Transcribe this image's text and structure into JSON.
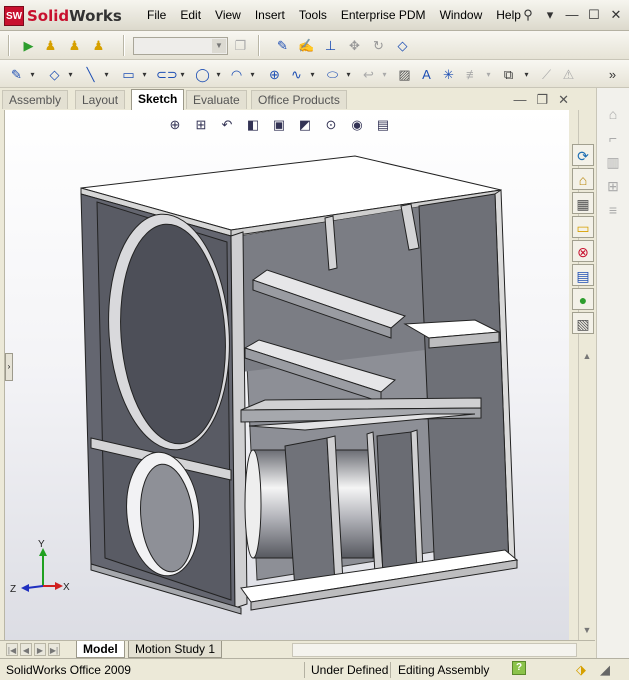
{
  "app": {
    "brand": "SolidWorks",
    "badge": "SW"
  },
  "menu": [
    "File",
    "Edit",
    "View",
    "Insert",
    "Tools",
    "Enterprise PDM",
    "Window",
    "Help"
  ],
  "command_tabs": [
    "Assembly",
    "Layout",
    "Sketch",
    "Evaluate",
    "Office Products"
  ],
  "active_command_tab": "Sketch",
  "bottom_tabs": [
    "Model",
    "Motion Study 1"
  ],
  "active_bottom_tab": "Model",
  "status": {
    "product": "SolidWorks Office 2009",
    "definition": "Under Defined",
    "mode": "Editing Assembly",
    "help": "?"
  },
  "triad": {
    "x": "X",
    "y": "Y",
    "z": "Z"
  },
  "colors": {
    "brand_red": "#c8102e",
    "play_green": "#2e9e2e",
    "sketch_blue": "#1e4fb4",
    "axis_x": "#d02020",
    "axis_y": "#20a020",
    "axis_z": "#2030c0"
  }
}
